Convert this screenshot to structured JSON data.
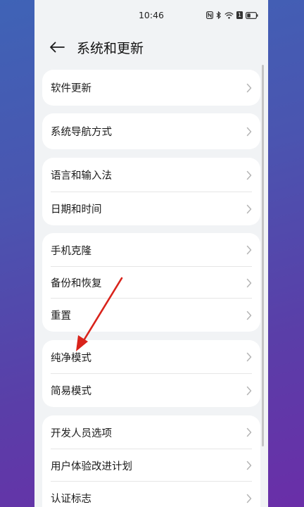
{
  "status_bar": {
    "time": "10:46",
    "icons": [
      "nfc-icon",
      "bluetooth-icon",
      "wifi-icon",
      "sim-icon",
      "battery-icon"
    ],
    "sim_label": "1"
  },
  "header": {
    "back_icon": "back-arrow-icon",
    "title": "系统和更新"
  },
  "groups": [
    {
      "items": [
        {
          "label": "软件更新"
        }
      ]
    },
    {
      "items": [
        {
          "label": "系统导航方式"
        }
      ]
    },
    {
      "items": [
        {
          "label": "语言和输入法"
        },
        {
          "label": "日期和时间"
        }
      ]
    },
    {
      "items": [
        {
          "label": "手机克隆"
        },
        {
          "label": "备份和恢复"
        },
        {
          "label": "重置"
        }
      ]
    },
    {
      "items": [
        {
          "label": "纯净模式"
        },
        {
          "label": "简易模式"
        }
      ]
    },
    {
      "items": [
        {
          "label": "开发人员选项"
        },
        {
          "label": "用户体验改进计划"
        },
        {
          "label": "认证标志"
        }
      ]
    }
  ],
  "colors": {
    "annotation_arrow": "#d9231b",
    "card_background": "#ffffff",
    "page_background": "#f1f3f5",
    "chevron": "#b5b5b5"
  }
}
